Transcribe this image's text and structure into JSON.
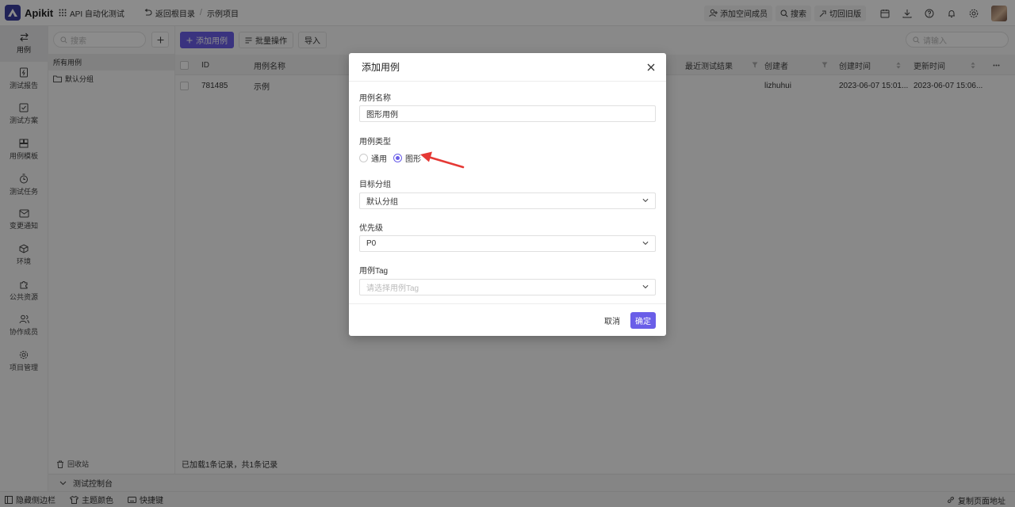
{
  "app": {
    "name": "Apikit",
    "project": "API 自动化测试",
    "back": "返回根目录",
    "breadcrumb": "示例项目"
  },
  "topbar": {
    "add_member": "添加空间成员",
    "search": "搜索",
    "switch_old": "切回旧版"
  },
  "nav": [
    {
      "label": "用例",
      "icon": "swap-icon"
    },
    {
      "label": "测试报告",
      "icon": "report-icon"
    },
    {
      "label": "测试方案",
      "icon": "checkbox-icon"
    },
    {
      "label": "用例模板",
      "icon": "template-icon"
    },
    {
      "label": "测试任务",
      "icon": "timer-icon"
    },
    {
      "label": "变更通知",
      "icon": "mail-icon"
    },
    {
      "label": "环境",
      "icon": "cube-icon"
    },
    {
      "label": "公共资源",
      "icon": "puzzle-icon"
    },
    {
      "label": "协作成员",
      "icon": "users-icon"
    },
    {
      "label": "项目管理",
      "icon": "gear-icon"
    }
  ],
  "groups": {
    "search_placeholder": "搜索",
    "all": "所有用例",
    "default": "默认分组",
    "recycle": "回收站"
  },
  "toolbar": {
    "add": "添加用例",
    "batch": "批量操作",
    "import": "导入",
    "search_placeholder": "请输入"
  },
  "table": {
    "headers": {
      "id": "ID",
      "name": "用例名称",
      "last_result": "最近测试结果",
      "creator": "创建者",
      "created": "创建时间",
      "updated": "更新时间"
    },
    "rows": [
      {
        "id": "781485",
        "name": "示例",
        "creator": "lizhuhui",
        "created": "2023-06-07 15:01...",
        "updated": "2023-06-07 15:06..."
      }
    ],
    "status": "已加载1条记录，共1条记录"
  },
  "console": "测试控制台",
  "footer": {
    "hide_sidebar": "隐藏侧边栏",
    "theme": "主题颜色",
    "shortcuts": "快捷键",
    "copy_url": "复制页面地址"
  },
  "modal": {
    "title": "添加用例",
    "name_label": "用例名称",
    "name_value": "图形用例",
    "type_label": "用例类型",
    "type_general": "通用",
    "type_graphic": "图形",
    "group_label": "目标分组",
    "group_value": "默认分组",
    "priority_label": "优先级",
    "priority_value": "P0",
    "tag_label": "用例Tag",
    "tag_placeholder": "请选择用例Tag",
    "cancel": "取消",
    "ok": "确定"
  },
  "colors": {
    "primary": "#6a5ee8",
    "annotation_arrow": "#e53935"
  }
}
